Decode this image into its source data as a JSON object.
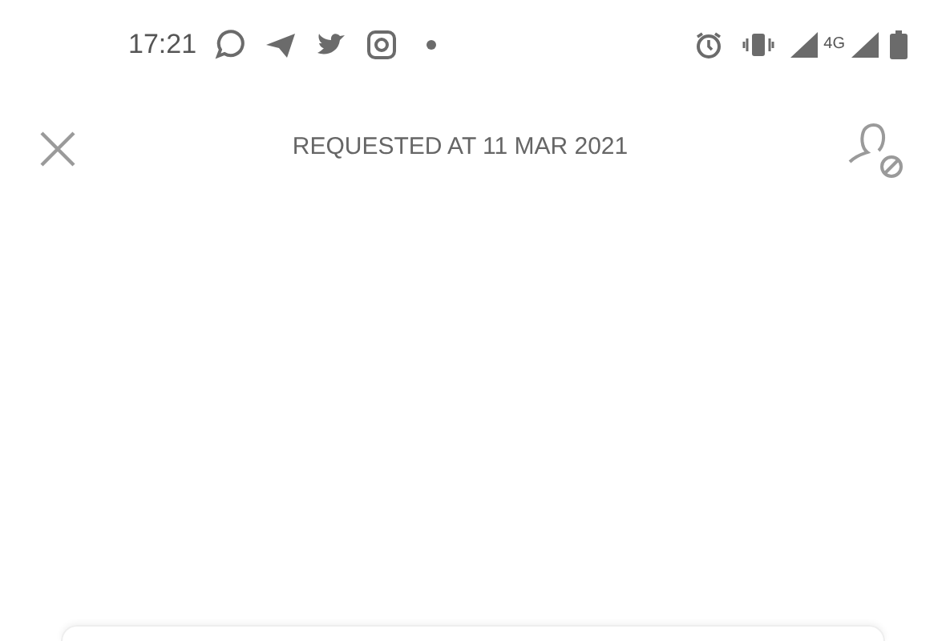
{
  "status_bar": {
    "time": "17:21",
    "network_label": "4G"
  },
  "header": {
    "title": "REQUESTED AT 11 MAR 2021"
  }
}
